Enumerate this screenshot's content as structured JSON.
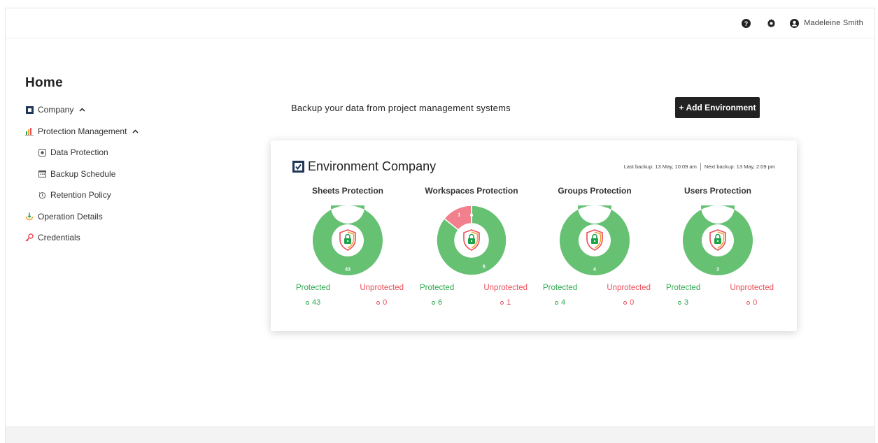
{
  "topbar": {
    "user_name": "Madeleine Smith",
    "icons": [
      "help-icon",
      "gear-icon",
      "user-icon"
    ]
  },
  "sidebar": {
    "title": "Home",
    "company": "Company",
    "protection_management": "Protection Management",
    "data_protection": "Data Protection",
    "backup_schedule": "Backup Schedule",
    "retention_policy": "Retention Policy",
    "operation_details": "Operation Details",
    "credentials": "Credentials"
  },
  "main": {
    "headline": "Backup your data from project management systems",
    "add_button": "+ Add Environment"
  },
  "card": {
    "title": "Environment Company",
    "last_backup": "Last backup: 13 May, 10:09 am",
    "next_backup": "Next backup: 13 May, 2:09 pm",
    "protected_label": "Protected",
    "unprotected_label": "Unprotected"
  },
  "colors": {
    "protected": "#66c173",
    "unprotected": "#f27f8c",
    "protected_text": "#2fa84f",
    "unprotected_text": "#ea4f5a"
  },
  "chart_data": [
    {
      "type": "pie",
      "title": "Sheets Protection",
      "categories": [
        "Protected",
        "Unprotected"
      ],
      "values": [
        43,
        0
      ],
      "labels": [
        "43",
        "0"
      ]
    },
    {
      "type": "pie",
      "title": "Workspaces Protection",
      "categories": [
        "Protected",
        "Unprotected"
      ],
      "values": [
        6,
        1
      ],
      "labels": [
        "6",
        "1"
      ]
    },
    {
      "type": "pie",
      "title": "Groups Protection",
      "categories": [
        "Protected",
        "Unprotected"
      ],
      "values": [
        4,
        0
      ],
      "labels": [
        "4",
        "0"
      ]
    },
    {
      "type": "pie",
      "title": "Users Protection",
      "categories": [
        "Protected",
        "Unprotected"
      ],
      "values": [
        3,
        0
      ],
      "labels": [
        "3",
        "0"
      ]
    }
  ]
}
